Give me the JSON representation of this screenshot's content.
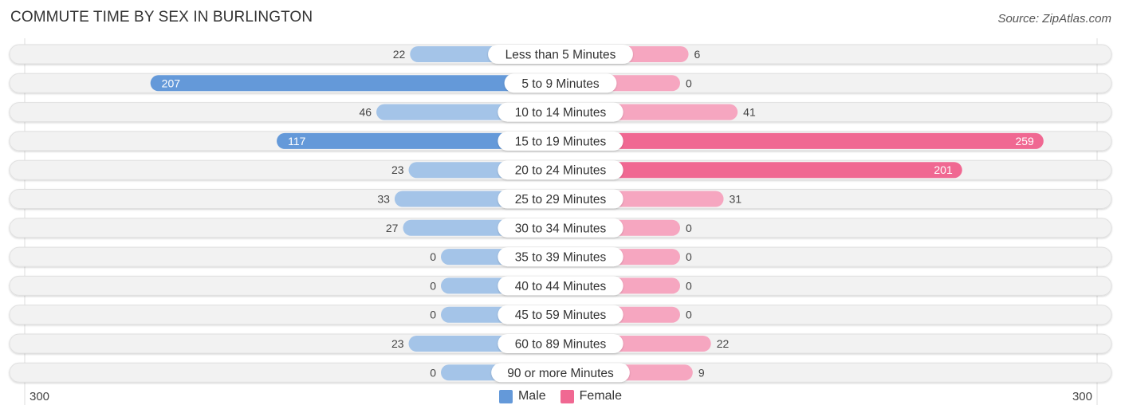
{
  "title": "COMMUTE TIME BY SEX IN BURLINGTON",
  "source": "Source: ZipAtlas.com",
  "colors": {
    "male_strong": "#6499d9",
    "male_light": "#a4c4e8",
    "female_strong": "#f06892",
    "female_light": "#f6a6c0",
    "track": "#f2f2f2"
  },
  "chart_data": {
    "type": "bar",
    "orientation": "horizontal-diverging",
    "title": "COMMUTE TIME BY SEX IN BURLINGTON",
    "categories": [
      "Less than 5 Minutes",
      "5 to 9 Minutes",
      "10 to 14 Minutes",
      "15 to 19 Minutes",
      "20 to 24 Minutes",
      "25 to 29 Minutes",
      "30 to 34 Minutes",
      "35 to 39 Minutes",
      "40 to 44 Minutes",
      "45 to 59 Minutes",
      "60 to 89 Minutes",
      "90 or more Minutes"
    ],
    "series": [
      {
        "name": "Male",
        "values": [
          22,
          207,
          46,
          117,
          23,
          33,
          27,
          0,
          0,
          0,
          23,
          0
        ]
      },
      {
        "name": "Female",
        "values": [
          6,
          0,
          41,
          259,
          201,
          31,
          0,
          0,
          0,
          0,
          22,
          9
        ]
      }
    ],
    "xlim": [
      300,
      300
    ],
    "axis_labels": {
      "left": "300",
      "right": "300"
    },
    "legend": {
      "position": "bottom-center",
      "entries": [
        "Male",
        "Female"
      ]
    },
    "grid": false
  }
}
